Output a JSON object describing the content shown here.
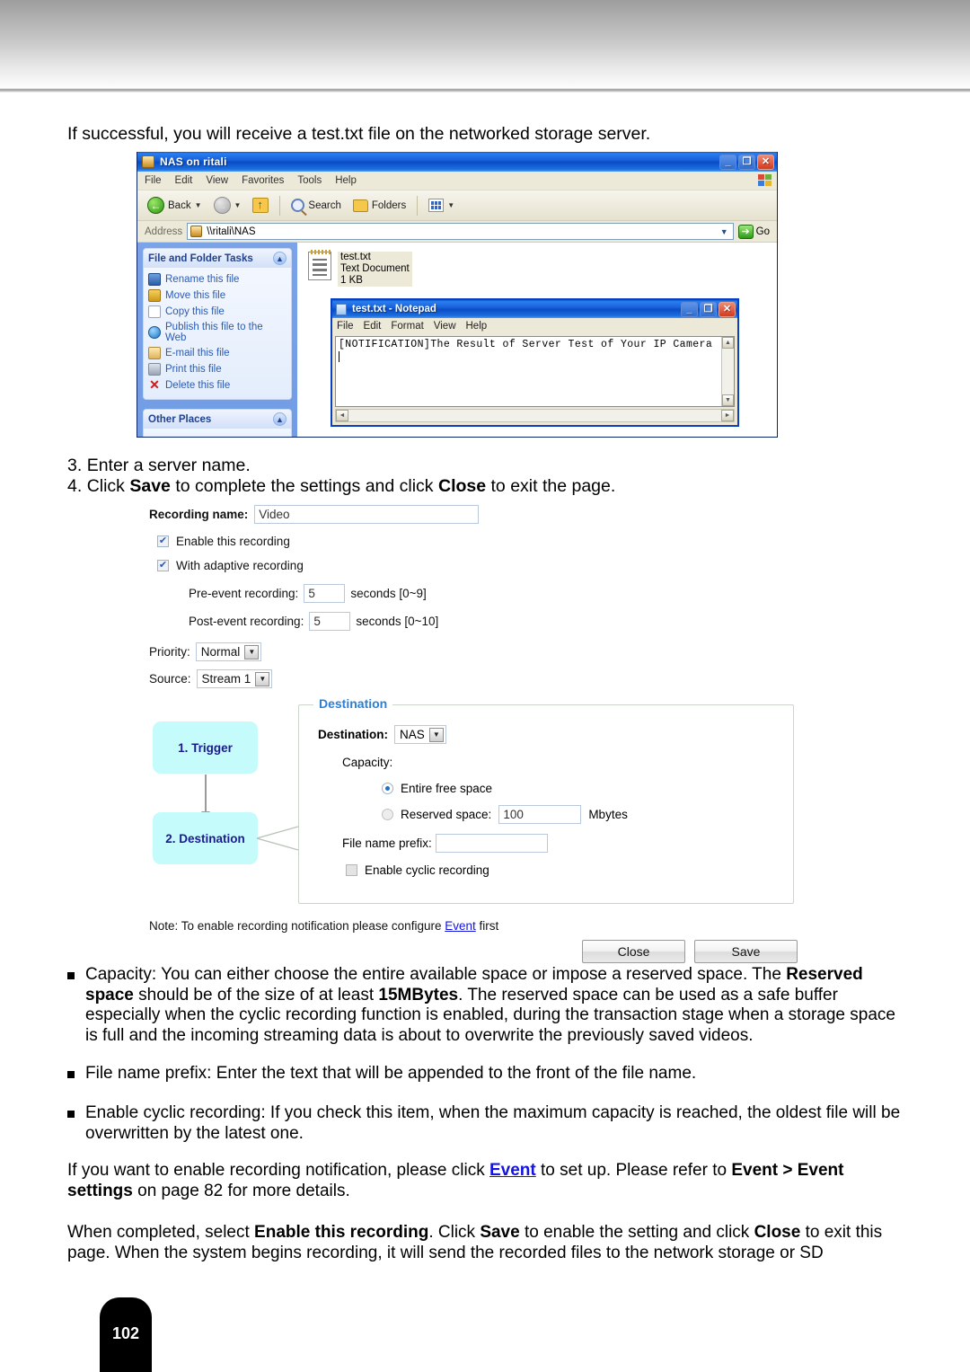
{
  "intro": "If successful, you will receive a test.txt file on the networked storage server.",
  "explorer": {
    "title": "NAS on ritali",
    "menus": [
      "File",
      "Edit",
      "View",
      "Favorites",
      "Tools",
      "Help"
    ],
    "toolbar": {
      "back": "Back",
      "search": "Search",
      "folders": "Folders"
    },
    "address_label": "Address",
    "address_value": "\\\\ritali\\NAS",
    "go_label": "Go",
    "tasks_panel": {
      "title": "File and Folder Tasks",
      "items": [
        "Rename this file",
        "Move this file",
        "Copy this file",
        "Publish this file to the Web",
        "E-mail this file",
        "Print this file",
        "Delete this file"
      ]
    },
    "other_places": {
      "title": "Other Places"
    },
    "file": {
      "name": "test.txt",
      "type": "Text Document",
      "size": "1 KB"
    }
  },
  "notepad": {
    "title": "test.txt - Notepad",
    "menus": [
      "File",
      "Edit",
      "Format",
      "View",
      "Help"
    ],
    "content": "[NOTIFICATION]The Result of Server Test of Your IP Camera"
  },
  "steps": [
    {
      "num": "3.",
      "text": "Enter a server name."
    },
    {
      "num": "4.",
      "prefix": "Click ",
      "b1": "Save",
      "mid": " to complete the settings and click ",
      "b2": "Close",
      "suffix": " to exit the page."
    }
  ],
  "form": {
    "recording_name_label": "Recording name:",
    "recording_name_value": "Video",
    "enable_recording_label": "Enable this recording",
    "enable_recording_checked": true,
    "adaptive_label": "With adaptive recording",
    "adaptive_checked": true,
    "pre_event_label": "Pre-event recording:",
    "pre_event_value": "5",
    "pre_event_units": "seconds [0~9]",
    "post_event_label": "Post-event recording:",
    "post_event_value": "5",
    "post_event_units": "seconds [0~10]",
    "priority_label": "Priority:",
    "priority_value": "Normal",
    "source_label": "Source:",
    "source_value": "Stream 1",
    "step1": "1. Trigger",
    "step2": "2. Destination",
    "destination": {
      "legend": "Destination",
      "dest_label": "Destination:",
      "dest_value": "NAS",
      "capacity_label": "Capacity:",
      "entire_label": "Entire free space",
      "entire_selected": true,
      "reserved_label": "Reserved space:",
      "reserved_value": "100",
      "reserved_units": "Mbytes",
      "prefix_label": "File name prefix:",
      "prefix_value": "",
      "cyclic_label": "Enable cyclic recording",
      "cyclic_checked": false
    },
    "note_prefix": "Note: To enable recording notification please configure ",
    "note_link": "Event",
    "note_suffix": " first",
    "close_button": "Close",
    "save_button": "Save"
  },
  "bullets": {
    "capacity": {
      "p1": "Capacity: You can either choose the entire available space or impose a reserved space. The ",
      "b1": "Reserved space",
      "p2": " should be of the size of at least ",
      "b2": "15MBytes",
      "p3": ". The reserved space can be used as a safe buffer especially when the cyclic recording function is enabled, during the transaction stage when a storage space is full and the incoming streaming data is about to overwrite the previously saved videos."
    },
    "prefix": "File name prefix: Enter the text that will be appended to the front of the file name.",
    "cyclic": "Enable cyclic recording: If you check this item, when the maximum capacity is reached, the oldest file will be overwritten by the latest one."
  },
  "paragraphs": {
    "event": {
      "p1": "If you want to enable recording notification, please click ",
      "link": "Event",
      "p2": " to set up. Please refer to ",
      "b1": "Event > Event settings",
      "p3": " on page 82 for more details."
    },
    "completed": {
      "p1": "When completed, select ",
      "b1": "Enable this recording",
      "p2": ". Click ",
      "b2": "Save",
      "p3": " to enable the setting and click ",
      "b3": "Close",
      "p4": " to exit this page. When the system begins recording, it will send the recorded files to the network storage or SD"
    }
  },
  "page_number": "102"
}
